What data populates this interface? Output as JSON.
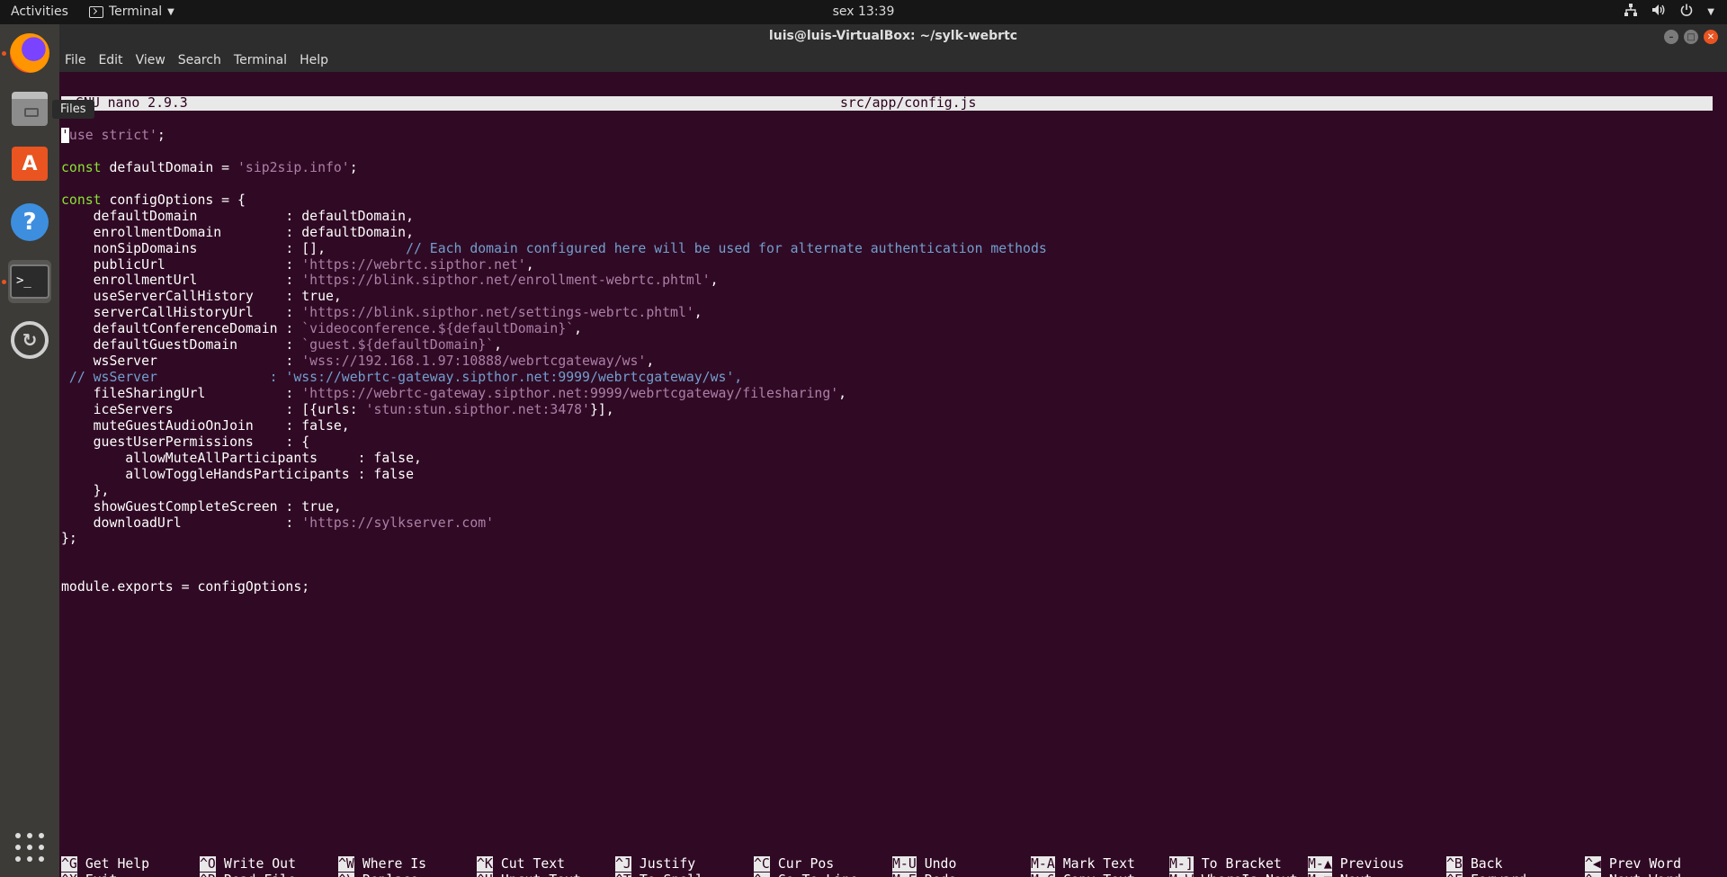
{
  "topbar": {
    "activities": "Activities",
    "app_name": "Terminal",
    "clock": "sex 13:39"
  },
  "dock": {
    "tooltip": "Files",
    "items": [
      "firefox-icon",
      "files-icon",
      "software-center-icon",
      "help-icon",
      "terminal-icon",
      "software-updater-icon"
    ]
  },
  "window": {
    "title": "luis@luis-VirtualBox: ~/sylk-webrtc",
    "menu": [
      "File",
      "Edit",
      "View",
      "Search",
      "Terminal",
      "Help"
    ]
  },
  "nano": {
    "version": "GNU nano 2.9.3",
    "filename": "src/app/config.js",
    "lines": [
      [
        [
          "cursor",
          "'"
        ],
        [
          "str",
          "use strict'"
        ],
        [
          "",
          "; "
        ]
      ],
      [],
      [
        [
          "kw",
          "const"
        ],
        [
          "",
          " defaultDomain = "
        ],
        [
          "str",
          "'sip2sip.info'"
        ],
        [
          "",
          ";"
        ]
      ],
      [],
      [
        [
          "kw",
          "const"
        ],
        [
          "",
          " configOptions = {"
        ]
      ],
      [
        [
          "",
          "    defaultDomain           : defaultDomain,"
        ]
      ],
      [
        [
          "",
          "    enrollmentDomain        : defaultDomain,"
        ]
      ],
      [
        [
          "",
          "    nonSipDomains           : [],          "
        ],
        [
          "cmt",
          "// Each domain configured here will be used for alternate authentication methods"
        ]
      ],
      [
        [
          "",
          "    publicUrl               : "
        ],
        [
          "str",
          "'https://webrtc.sipthor.net'"
        ],
        [
          "",
          ","
        ]
      ],
      [
        [
          "",
          "    enrollmentUrl           : "
        ],
        [
          "str",
          "'https://blink.sipthor.net/enrollment-webrtc.phtml'"
        ],
        [
          "",
          ","
        ]
      ],
      [
        [
          "",
          "    useServerCallHistory    : true,"
        ]
      ],
      [
        [
          "",
          "    serverCallHistoryUrl    : "
        ],
        [
          "str",
          "'https://blink.sipthor.net/settings-webrtc.phtml'"
        ],
        [
          "",
          ","
        ]
      ],
      [
        [
          "",
          "    defaultConferenceDomain : "
        ],
        [
          "str",
          "`videoconference.${defaultDomain}`"
        ],
        [
          "",
          ","
        ]
      ],
      [
        [
          "",
          "    defaultGuestDomain      : "
        ],
        [
          "str",
          "`guest.${defaultDomain}`"
        ],
        [
          "",
          ","
        ]
      ],
      [
        [
          "",
          "    wsServer                : "
        ],
        [
          "str",
          "'wss://192.168.1.97:10888/webrtcgateway/ws'"
        ],
        [
          "",
          ","
        ]
      ],
      [
        [
          "cmt",
          " // wsServer              : 'wss://webrtc-gateway.sipthor.net:9999/webrtcgateway/ws',"
        ]
      ],
      [
        [
          "",
          "    fileSharingUrl          : "
        ],
        [
          "str",
          "'https://webrtc-gateway.sipthor.net:9999/webrtcgateway/filesharing'"
        ],
        [
          "",
          ","
        ]
      ],
      [
        [
          "",
          "    iceServers              : [{urls: "
        ],
        [
          "str",
          "'stun:stun.sipthor.net:3478'"
        ],
        [
          "",
          "}],"
        ]
      ],
      [
        [
          "",
          "    muteGuestAudioOnJoin    : false,"
        ]
      ],
      [
        [
          "",
          "    guestUserPermissions    : {"
        ]
      ],
      [
        [
          "",
          "        allowMuteAllParticipants     : false,"
        ]
      ],
      [
        [
          "",
          "        allowToggleHandsParticipants : false"
        ]
      ],
      [
        [
          "",
          "    },"
        ]
      ],
      [
        [
          "",
          "    showGuestCompleteScreen : true,"
        ]
      ],
      [
        [
          "",
          "    downloadUrl             : "
        ],
        [
          "str",
          "'https://sylkserver.com'"
        ]
      ],
      [
        [
          "",
          "};"
        ]
      ],
      [],
      [],
      [
        [
          "",
          "module.exports = configOptions;"
        ]
      ]
    ],
    "shortcuts_row1": [
      {
        "key": "^G",
        "label": "Get Help"
      },
      {
        "key": "^O",
        "label": "Write Out"
      },
      {
        "key": "^W",
        "label": "Where Is"
      },
      {
        "key": "^K",
        "label": "Cut Text"
      },
      {
        "key": "^J",
        "label": "Justify"
      },
      {
        "key": "^C",
        "label": "Cur Pos"
      },
      {
        "key": "M-U",
        "label": "Undo"
      },
      {
        "key": "M-A",
        "label": "Mark Text"
      },
      {
        "key": "M-]",
        "label": "To Bracket"
      },
      {
        "key": "M-▲",
        "label": "Previous"
      },
      {
        "key": "^B",
        "label": "Back"
      },
      {
        "key": "^◀",
        "label": "Prev Word"
      }
    ],
    "shortcuts_row2": [
      {
        "key": "^X",
        "label": "Exit"
      },
      {
        "key": "^R",
        "label": "Read File"
      },
      {
        "key": "^\\",
        "label": "Replace"
      },
      {
        "key": "^U",
        "label": "Uncut Text"
      },
      {
        "key": "^T",
        "label": "To Spell"
      },
      {
        "key": "^_",
        "label": "Go To Line"
      },
      {
        "key": "M-E",
        "label": "Redo"
      },
      {
        "key": "M-6",
        "label": "Copy Text"
      },
      {
        "key": "M-W",
        "label": "WhereIs Next"
      },
      {
        "key": "M-▼",
        "label": "Next"
      },
      {
        "key": "^F",
        "label": "Forward"
      },
      {
        "key": "^▶",
        "label": "Next Word"
      }
    ]
  }
}
